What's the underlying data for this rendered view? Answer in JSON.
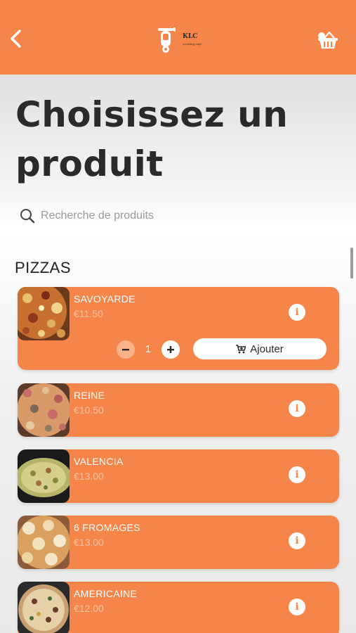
{
  "header": {
    "back_icon": "chevron-left-icon",
    "logo_text": "KLC",
    "logo_subtitle": "scooting cafe",
    "cart_icon": "basket-icon",
    "background_color": "#f6854a"
  },
  "page": {
    "title": "Choisissez un produit"
  },
  "search": {
    "icon": "search-icon",
    "placeholder": "Recherche de produits",
    "value": ""
  },
  "section": {
    "title": "PIZZAS"
  },
  "products": [
    {
      "name": "SAVOYARDE",
      "price": "€11.50",
      "image": "pizza-savoyarde",
      "expanded": true
    },
    {
      "name": "REINE",
      "price": "€10.50",
      "image": "pizza-reine"
    },
    {
      "name": "VALENCIA",
      "price": "€13.00",
      "image": "pizza-valencia"
    },
    {
      "name": "6 FROMAGES",
      "price": "€13.00",
      "image": "pizza-6-fromages"
    },
    {
      "name": "AMERICAINE",
      "price": "€12.00",
      "image": "pizza-americaine"
    }
  ],
  "expanded_item": {
    "quantity": "1",
    "add_label": "Ajouter",
    "add_icon": "cart-add-icon"
  },
  "colors": {
    "accent": "#f6854a",
    "price_text": "#fbc4a3",
    "minus_button": "#fbb18a"
  }
}
